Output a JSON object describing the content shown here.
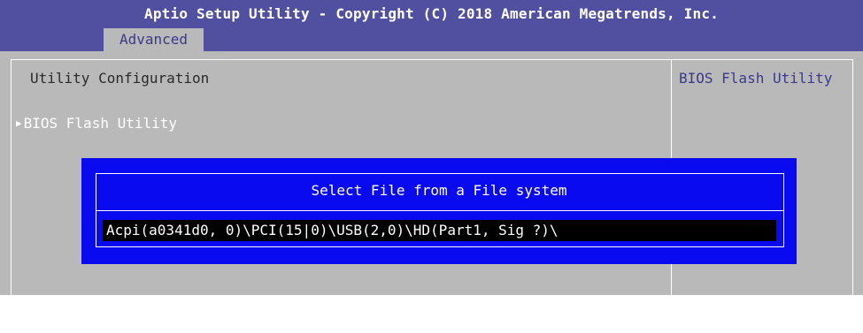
{
  "header": {
    "title": "Aptio Setup Utility - Copyright (C) 2018 American Megatrends, Inc.",
    "active_tab": "Advanced"
  },
  "main": {
    "section_title": "Utility Configuration",
    "menu_items": [
      {
        "label": "BIOS Flash Utility",
        "icon": "triangle-right-icon"
      }
    ]
  },
  "help": {
    "text": "BIOS Flash Utility"
  },
  "dialog": {
    "title": "Select File from a File system",
    "path": "Acpi(a0341d0, 0)\\PCI(15|0)\\USB(2,0)\\HD(Part1, Sig ?)\\"
  },
  "colors": {
    "header_bg": "#5150a0",
    "body_bg": "#b9b9b9",
    "dialog_bg": "#0a0af0",
    "field_bg": "#000000"
  }
}
